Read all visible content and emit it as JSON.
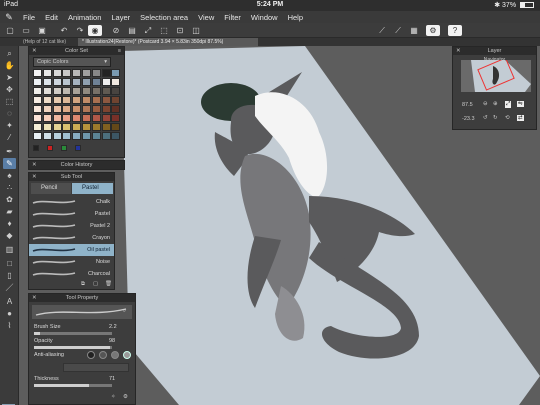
{
  "status": {
    "device": "iPad",
    "time": "5:24 PM",
    "battery": "37%",
    "battery_level": 0.37
  },
  "menu": [
    "File",
    "Edit",
    "Animation",
    "Layer",
    "Selection area",
    "View",
    "Filter",
    "Window",
    "Help"
  ],
  "tabs": {
    "inactive": "(Help of 12 cat like)",
    "active": "* Illustration24(Restore)* (Postcard 3.94 × 5.83in 350dpi 87.5%)"
  },
  "color_set": {
    "title": "Color Set",
    "set_name": "Copic Colors",
    "bottom_colors": [
      "#222222",
      "#cc2222",
      "#2a8a3a",
      "#223399"
    ]
  },
  "color_history": {
    "title": "Color History"
  },
  "sub_tool": {
    "title": "Sub Tool",
    "tabs": [
      "Pencil",
      "Pastel"
    ],
    "brushes": [
      "Chalk",
      "Pastel",
      "Pastel 2",
      "Crayon",
      "Oil pastel",
      "Noise",
      "Charcoal"
    ],
    "selected_index": 4
  },
  "tool_property": {
    "title": "Tool Property",
    "brush_size_label": "Brush Size",
    "brush_size_value": "2.2",
    "opacity_label": "Opacity",
    "opacity_value": "98",
    "opacity_level": 0.98,
    "anti_aliasing_label": "Anti-aliasing",
    "thickness_label": "Thickness",
    "thickness_value": "71",
    "thickness_level": 0.71
  },
  "layer": {
    "title": "Layer",
    "navigator_title": "Navigator",
    "zoom": "87.5",
    "rotation": "-23.3"
  },
  "colors": {
    "paper": "#c3ccd4",
    "dragon_dark": "#5a5a5c",
    "dragon_mid": "#77777a",
    "dragon_light": "#8e8e92",
    "hair": "#f4f4f4",
    "hat": "#2b3a32",
    "accent": "#5a7ea6"
  }
}
